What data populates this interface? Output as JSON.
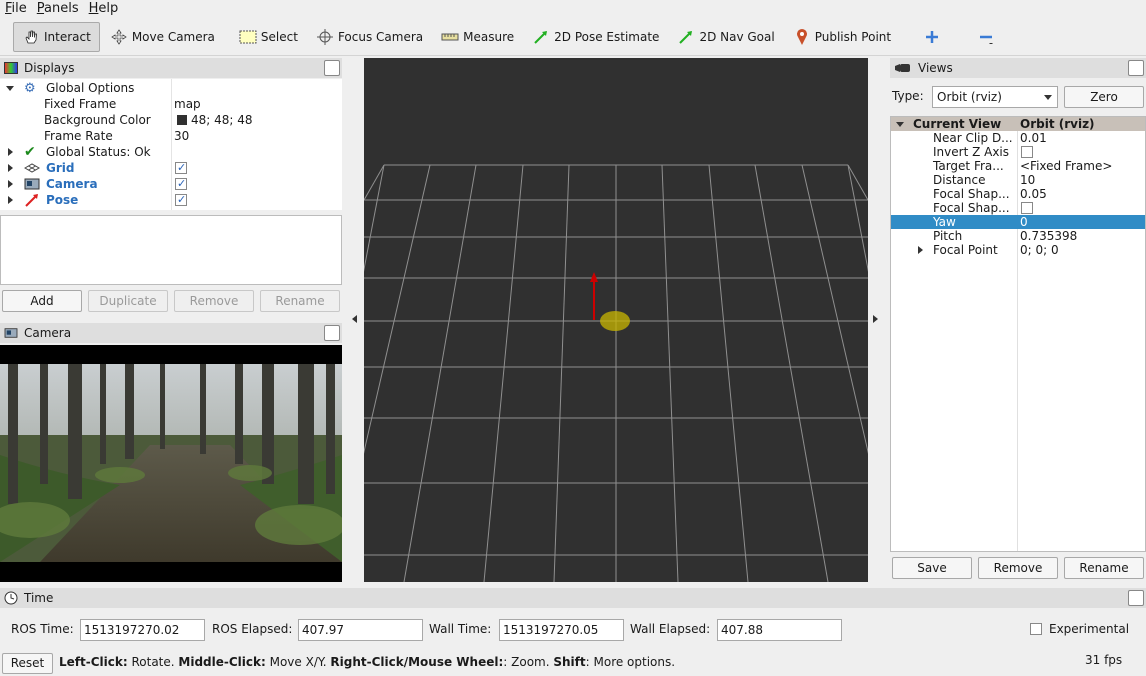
{
  "menu": [
    "File",
    "Panels",
    "Help"
  ],
  "toolbar": {
    "interact": "Interact",
    "move_camera": "Move Camera",
    "select": "Select",
    "focus_camera": "Focus Camera",
    "measure": "Measure",
    "pose_estimate": "2D Pose Estimate",
    "nav_goal": "2D Nav Goal",
    "publish_point": "Publish Point"
  },
  "displays": {
    "title": "Displays",
    "global_options": "Global Options",
    "fixed_frame_label": "Fixed Frame",
    "fixed_frame_value": "map",
    "bg_color_label": "Background Color",
    "bg_color_value": "48; 48; 48",
    "frame_rate_label": "Frame Rate",
    "frame_rate_value": "30",
    "global_status": "Global Status: Ok",
    "grid": "Grid",
    "camera": "Camera",
    "pose": "Pose",
    "buttons": {
      "add": "Add",
      "duplicate": "Duplicate",
      "remove": "Remove",
      "rename": "Rename"
    }
  },
  "camera_panel": {
    "title": "Camera"
  },
  "views": {
    "title": "Views",
    "type_label": "Type:",
    "type_value": "Orbit (rviz)",
    "zero": "Zero",
    "current_view": "Current View",
    "current_view_value": "Orbit (rviz)",
    "props": [
      {
        "name": "Near Clip D...",
        "value": "0.01"
      },
      {
        "name": "Invert Z Axis",
        "value": ""
      },
      {
        "name": "Target Fra...",
        "value": "<Fixed Frame>"
      },
      {
        "name": "Distance",
        "value": "10"
      },
      {
        "name": "Focal Shap...",
        "value": "0.05"
      },
      {
        "name": "Focal Shap...",
        "value": ""
      },
      {
        "name": "Yaw",
        "value": "0"
      },
      {
        "name": "Pitch",
        "value": "0.735398"
      },
      {
        "name": "Focal Point",
        "value": "0; 0; 0"
      }
    ],
    "buttons": {
      "save": "Save",
      "remove": "Remove",
      "rename": "Rename"
    }
  },
  "time": {
    "title": "Time",
    "ros_time_label": "ROS Time:",
    "ros_time_value": "1513197270.02",
    "ros_elapsed_label": "ROS Elapsed:",
    "ros_elapsed_value": "407.97",
    "wall_time_label": "Wall Time:",
    "wall_time_value": "1513197270.05",
    "wall_elapsed_label": "Wall Elapsed:",
    "wall_elapsed_value": "407.88",
    "experimental": "Experimental"
  },
  "statusbar": {
    "reset": "Reset",
    "left_click": "Left-Click:",
    "left_click_desc": " Rotate. ",
    "middle_click": "Middle-Click:",
    "middle_click_desc": " Move X/Y. ",
    "right_click": "Right-Click/Mouse Wheel:",
    "right_click_desc": ": Zoom. ",
    "shift": "Shift",
    "shift_desc": ": More options.",
    "fps": "31 fps"
  },
  "colors": {
    "viewport_bg": "#303030",
    "selection": "#308cc6",
    "pose_arrow": "#cc0000"
  }
}
